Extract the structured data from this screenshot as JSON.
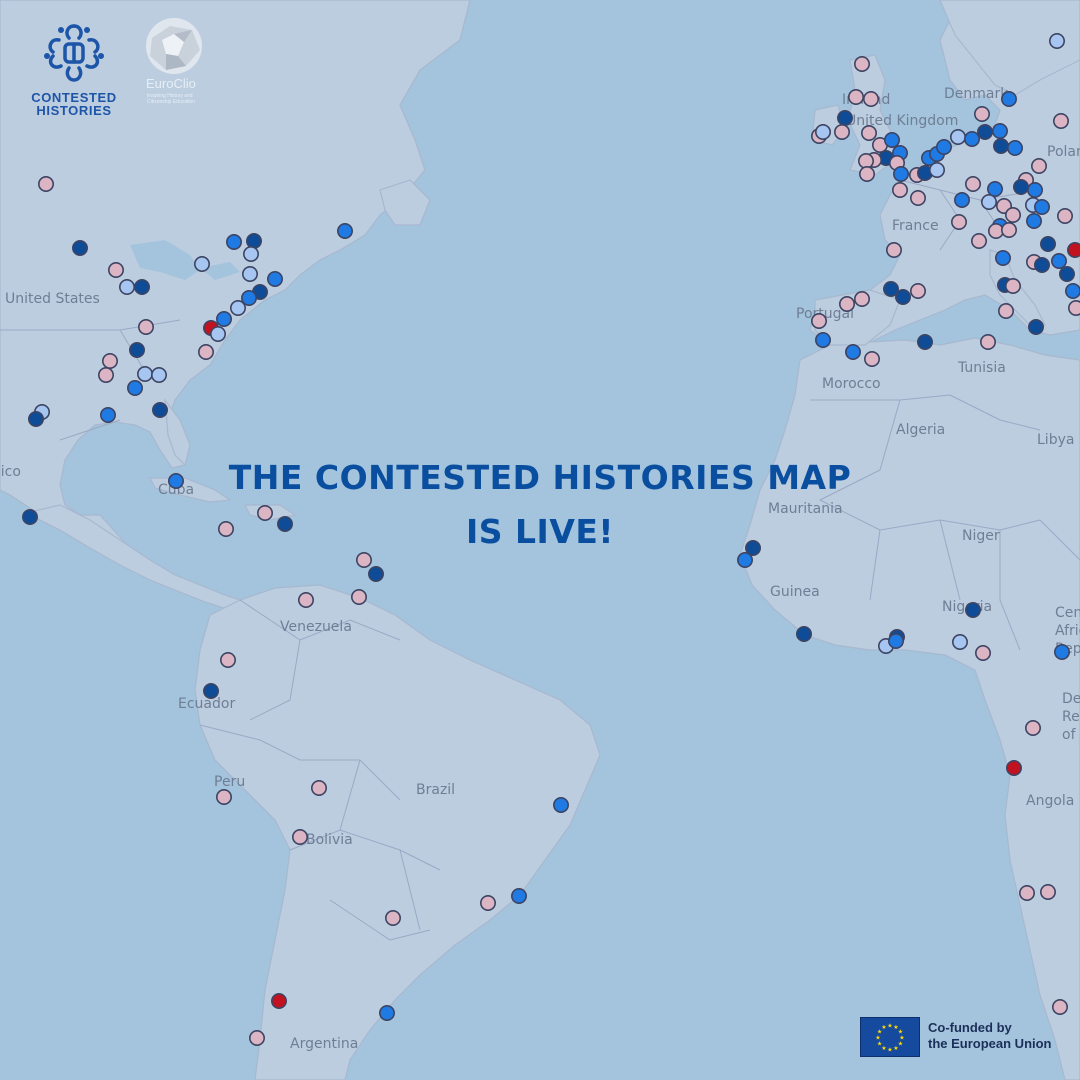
{
  "headline": {
    "line1": "THE CONTESTED HISTORIES MAP",
    "line2": "IS LIVE!"
  },
  "logos": {
    "contested_histories": {
      "line1": "CONTESTED",
      "line2": "HISTORIES"
    },
    "euroclio": {
      "name": "EuroClio",
      "tagline": "Inspiring History and Citizenship Education"
    }
  },
  "eu_badge": {
    "line1": "Co-funded by",
    "line2": "the European Union"
  },
  "country_labels": [
    "United States",
    "Denmark",
    "Ireland",
    "United Kingdom",
    "Poland",
    "France",
    "Portugal",
    "Morocco",
    "Tunisia",
    "Algeria",
    "Libya",
    "Mexico",
    "Cuba",
    "Mauritania",
    "Niger",
    "Guinea",
    "Nigeria",
    "Central African Republic",
    "Venezuela",
    "Ecuador",
    "Peru",
    "Brazil",
    "Bolivia",
    "Democratic Republic of the Congo",
    "Angola",
    "Argentina"
  ],
  "marker_colors": {
    "pink": "#dbb5c3",
    "light_blue": "#a6c6f1",
    "blue": "#1f7ae4",
    "dark_blue": "#0f4c98",
    "red": "#c3121f"
  },
  "colors": {
    "ocean": "#a3c4dc",
    "land": "#bdcde0",
    "headline": "#0a4ea0"
  }
}
